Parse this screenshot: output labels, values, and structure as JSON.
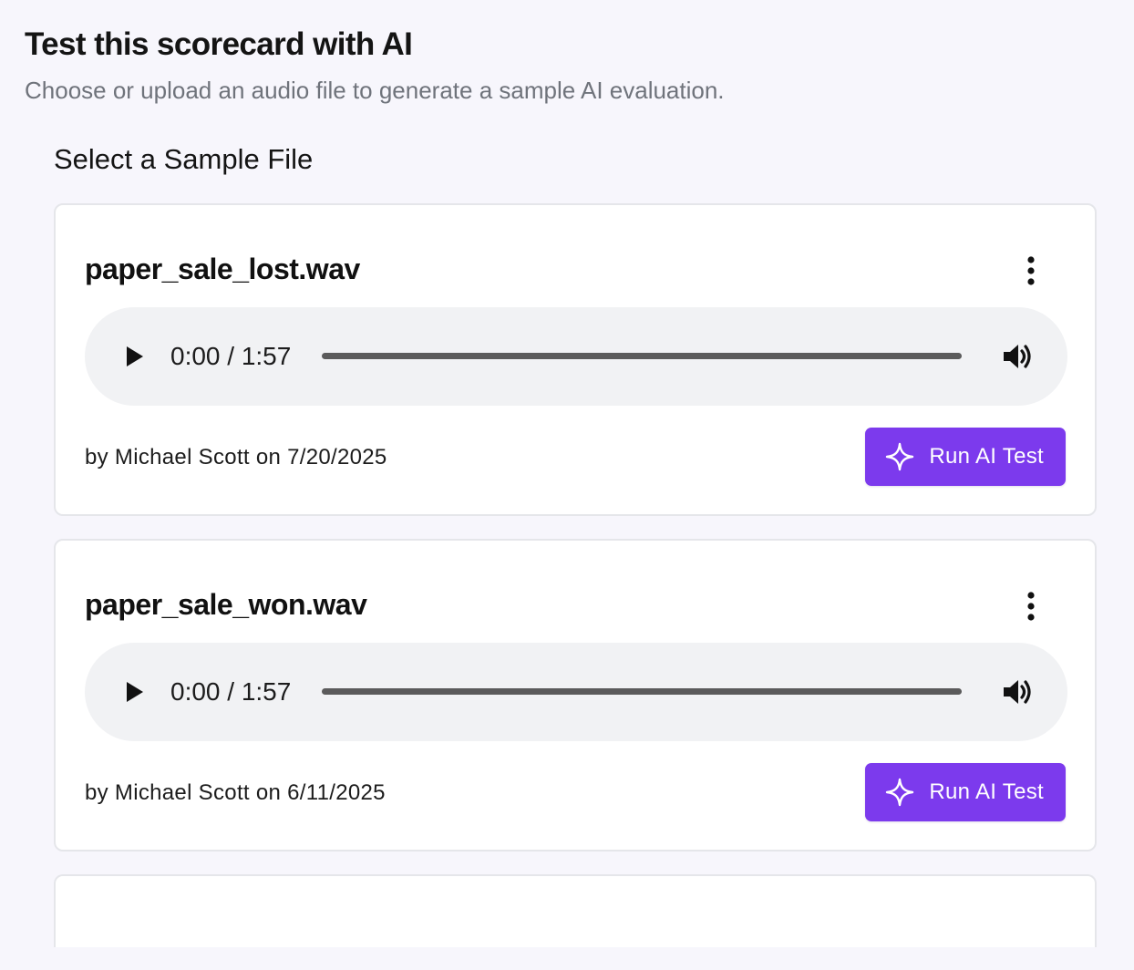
{
  "header": {
    "title": "Test this scorecard with AI",
    "subtitle": "Choose or upload an audio file to generate a sample AI evaluation."
  },
  "section": {
    "title": "Select a Sample File"
  },
  "colors": {
    "accent": "#7c3aed",
    "page_background": "#f7f6fc",
    "card_background": "#ffffff",
    "player_background": "#f1f2f4"
  },
  "icons": {
    "more": "vertical-ellipsis-icon",
    "play": "play-icon",
    "volume": "volume-icon",
    "run": "sparkle-icon"
  },
  "files": [
    {
      "name": "paper_sale_lost.wav",
      "player": {
        "time": "0:00 / 1:57",
        "progress": 0
      },
      "meta": "by Michael Scott on 7/20/2025",
      "run_label": "Run AI Test"
    },
    {
      "name": "paper_sale_won.wav",
      "player": {
        "time": "0:00 / 1:57",
        "progress": 0
      },
      "meta": "by Michael Scott on 6/11/2025",
      "run_label": "Run AI Test"
    }
  ]
}
